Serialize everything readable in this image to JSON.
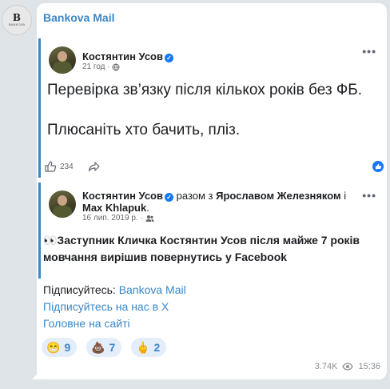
{
  "channel": {
    "name": "Bankova Mail",
    "avatar_letter": "B",
    "avatar_caption": "BANKOVA"
  },
  "post1": {
    "author": "Костянтин Усов",
    "time": "21 год",
    "line1": "Перевірка зв’язку після кількох років без ФБ.",
    "line2": "Плюсаніть хто бачить, пліз.",
    "like_count": "234"
  },
  "post2": {
    "author": "Костянтин Усов",
    "with_text": "разом з",
    "coauthor1": "Ярославом Железняком",
    "and_text": "і",
    "coauthor2": "Max Khlapuk",
    "date": "16 лип. 2019 р."
  },
  "message": {
    "headline": "👀Заступник Кличка Костянтин Усов після майже 7 років мовчання вирішив повернутись у Facebook",
    "subscribe_prefix": "Підписуйтесь: ",
    "subscribe_link": "Bankova Mail",
    "x_link": "Підписуйтесь на нас в X",
    "site_link": "Головне на сайті"
  },
  "reactions": [
    {
      "emoji": "😁",
      "count": "9"
    },
    {
      "emoji": "💩",
      "count": "7"
    },
    {
      "emoji": "🖕",
      "count": "2"
    }
  ],
  "footer": {
    "views": "3.74K",
    "time": "15:36"
  },
  "colors": {
    "accent": "#3a87c7",
    "facebook_blue": "#1877f2",
    "background": "#dfe4e9"
  }
}
